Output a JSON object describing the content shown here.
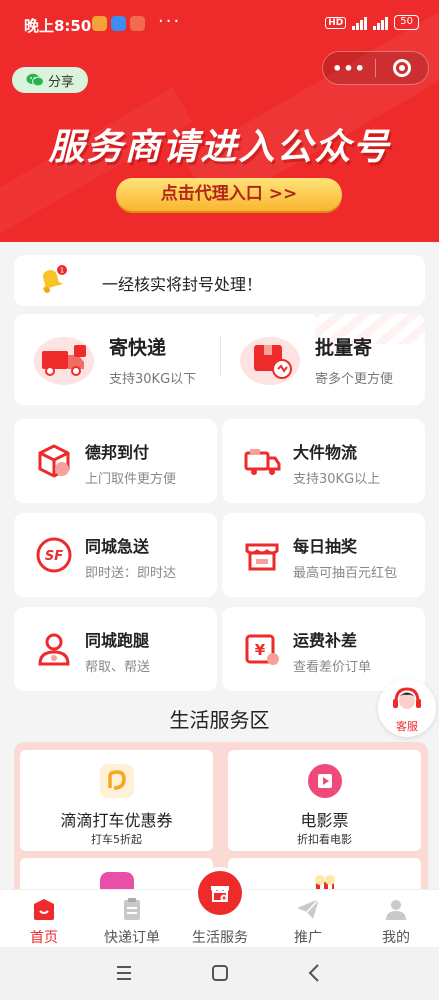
{
  "status_bar": {
    "time": "晚上8:50",
    "more": "···",
    "hd": "HD",
    "battery": "50"
  },
  "header": {
    "share_label": "分享",
    "capsule_more": "•••"
  },
  "banner": {
    "title": "服务商请进入公众号",
    "button_label": "点击代理入口 >>"
  },
  "notice": {
    "text": "一经核实将封号处理！",
    "badge": "1"
  },
  "express": [
    {
      "title": "寄快递",
      "subtitle": "支持30KG以下"
    },
    {
      "title": "批量寄",
      "subtitle": "寄多个更方便"
    }
  ],
  "services": [
    {
      "title": "德邦到付",
      "subtitle": "上门取件更方便",
      "icon": "box-icon"
    },
    {
      "title": "大件物流",
      "subtitle": "支持30KG以上",
      "icon": "truck-icon"
    },
    {
      "title": "同城急送",
      "subtitle": "即时送：即时达",
      "icon": "sf-icon"
    },
    {
      "title": "每日抽奖",
      "subtitle": "最高可抽百元红包",
      "icon": "shop-icon"
    },
    {
      "title": "同城跑腿",
      "subtitle": "帮取、帮送",
      "icon": "user-icon"
    },
    {
      "title": "运费补差",
      "subtitle": "查看差价订单",
      "icon": "yen-icon"
    }
  ],
  "life_section": {
    "title": "生活服务区",
    "items": [
      {
        "title": "滴滴打车优惠券",
        "subtitle": "打车5折起"
      },
      {
        "title": "电影票",
        "subtitle": "折扣看电影"
      }
    ]
  },
  "customer_service": {
    "label": "客服"
  },
  "tabbar": {
    "items": [
      {
        "label": "首页"
      },
      {
        "label": "快递订单"
      },
      {
        "label": "生活服务"
      },
      {
        "label": "推广"
      },
      {
        "label": "我的"
      }
    ]
  },
  "colors": {
    "brand": "#ee2a2b",
    "gold": "#f9b62e",
    "life_bg": "#fbd9d4"
  }
}
